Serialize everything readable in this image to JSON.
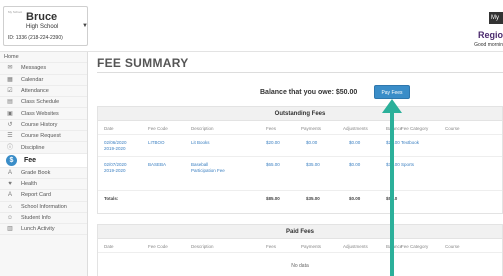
{
  "header": {
    "school_small": "My School",
    "school_name": "Bruce",
    "school_sub": "High School",
    "school_code": "ID: 1336  (218-224-2390)",
    "user_short": "My",
    "region_partial": "Regio",
    "greeting_partial": "Good mornin"
  },
  "sidebar": {
    "items": [
      {
        "label": "Home",
        "icon": "home-icon",
        "glyph": ""
      },
      {
        "label": "Messages",
        "icon": "messages-icon",
        "glyph": "✉"
      },
      {
        "label": "Calendar",
        "icon": "calendar-icon",
        "glyph": "▦"
      },
      {
        "label": "Attendance",
        "icon": "attendance-icon",
        "glyph": "☑"
      },
      {
        "label": "Class Schedule",
        "icon": "class-schedule-icon",
        "glyph": "▤"
      },
      {
        "label": "Class Websites",
        "icon": "class-websites-icon",
        "glyph": "▣"
      },
      {
        "label": "Course History",
        "icon": "course-history-icon",
        "glyph": "↺"
      },
      {
        "label": "Course Request",
        "icon": "course-request-icon",
        "glyph": "☰"
      },
      {
        "label": "Discipline",
        "icon": "discipline-icon",
        "glyph": "ⓘ"
      },
      {
        "label": "Fee",
        "icon": "fee-icon",
        "glyph": "$"
      },
      {
        "label": "Grade Book",
        "icon": "grade-book-icon",
        "glyph": "A"
      },
      {
        "label": "Health",
        "icon": "health-icon",
        "glyph": "♥"
      },
      {
        "label": "Report Card",
        "icon": "report-card-icon",
        "glyph": "A"
      },
      {
        "label": "School Information",
        "icon": "school-information-icon",
        "glyph": "⌂"
      },
      {
        "label": "Student Info",
        "icon": "student-info-icon",
        "glyph": "☺"
      },
      {
        "label": "Lunch Activity",
        "icon": "lunch-activity-icon",
        "glyph": "▥"
      }
    ]
  },
  "main": {
    "title": "FEE SUMMARY",
    "balance_text": "Balance that you owe: $50.00",
    "pay_button": "Pay Fees"
  },
  "outstanding": {
    "heading": "Outstanding Fees",
    "columns": [
      "Date",
      "Fee Code",
      "Description",
      "Fees",
      "Payments",
      "Adjustments",
      "Balance",
      "Fee Category",
      "Course"
    ],
    "rows": [
      {
        "date": "02/06/2020",
        "year": "2019-2020",
        "code": "LITBOO",
        "desc": "Lit Books",
        "fees": "$20.00",
        "payments": "$0.00",
        "adjustments": "$0.00",
        "balance": "$20.00",
        "category": "Textbook",
        "course": ""
      },
      {
        "date": "02/07/2020",
        "year": "2019-2020",
        "code": "BASEBA",
        "desc": "Baseball Participation Fee",
        "fees": "$65.00",
        "payments": "$35.00",
        "adjustments": "$0.00",
        "balance": "$30.00",
        "category": "Sports",
        "course": ""
      }
    ],
    "totals": {
      "label": "Totals:",
      "fees": "$85.00",
      "payments": "$35.00",
      "adjustments": "$0.00",
      "balance": "$50.0"
    }
  },
  "paid": {
    "heading": "Paid Fees",
    "columns": [
      "Date",
      "Fee Code",
      "Description",
      "Fees",
      "Payments",
      "Adjustments",
      "Balance",
      "Fee Category",
      "Course"
    ],
    "no_data": "No data"
  },
  "colors": {
    "accent": "#3a8dc8",
    "arrow": "#2bb09a",
    "region": "#4b2a6e"
  }
}
